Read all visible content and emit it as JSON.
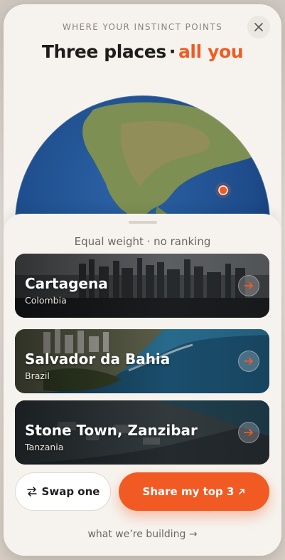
{
  "header": {
    "eyebrow": "WHERE YOUR INSTINCT POINTS",
    "title_main": "Three places",
    "title_separator": "·",
    "title_accent": "all you"
  },
  "sheet": {
    "subtitle": "Equal weight · no ranking",
    "places": [
      {
        "name": "Cartagena",
        "country": "Colombia"
      },
      {
        "name": "Salvador da Bahia",
        "country": "Brazil"
      },
      {
        "name": "Stone Town, Zanzibar",
        "country": "Tanzania"
      }
    ]
  },
  "actions": {
    "swap_label": "Swap one",
    "share_label": "Share my top 3",
    "footer_link": "what we’re building →"
  },
  "colors": {
    "accent": "#f25a23",
    "background": "#f6f3ee"
  },
  "icons": {
    "close": "close-icon",
    "swap": "swap-icon",
    "share": "arrow-up-right-icon",
    "card_action": "arrow-right-icon"
  }
}
